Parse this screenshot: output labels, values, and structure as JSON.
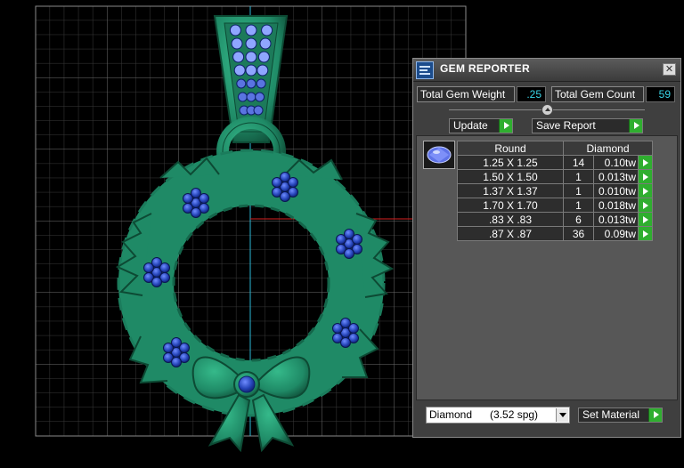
{
  "panel": {
    "title": "GEM REPORTER",
    "close_glyph": "✕",
    "icon": "gem-reporter-app-icon"
  },
  "stats": {
    "total_weight_label": "Total Gem Weight",
    "total_weight_value": ".25",
    "total_count_label": "Total Gem Count",
    "total_count_value": "59"
  },
  "actions": {
    "update_label": "Update",
    "save_label": "Save Report",
    "set_material_label": "Set Material"
  },
  "table": {
    "headers": [
      "Round",
      "Diamond"
    ],
    "rows": [
      {
        "size": "1.25 X 1.25",
        "qty": "14",
        "weight": "0.10tw"
      },
      {
        "size": "1.50 X 1.50",
        "qty": "1",
        "weight": "0.013tw"
      },
      {
        "size": "1.37 X 1.37",
        "qty": "1",
        "weight": "0.010tw"
      },
      {
        "size": "1.70 X 1.70",
        "qty": "1",
        "weight": "0.018tw"
      },
      {
        "size": ".83 X .83",
        "qty": "6",
        "weight": "0.013tw"
      },
      {
        "size": ".87 X .87",
        "qty": "36",
        "weight": "0.09tw"
      }
    ]
  },
  "material": {
    "selected": "Diamond      (3.52 spg)"
  },
  "colors": {
    "metal": "#1f8a66",
    "gem": "#1f3fb0",
    "accent_value": "#38d4e6",
    "go_green": "#2fae2f"
  }
}
